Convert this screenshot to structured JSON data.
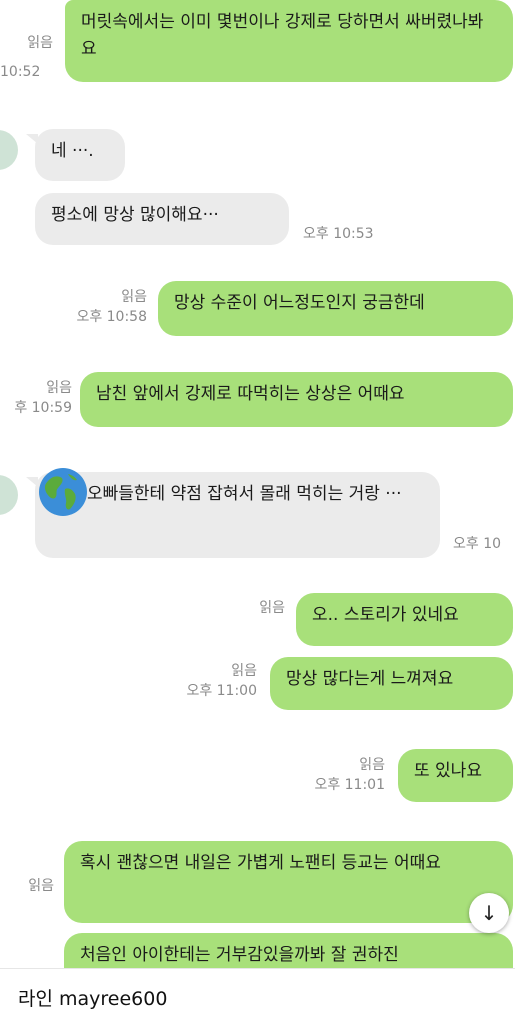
{
  "chat": {
    "messages": [
      {
        "sender": "me",
        "text": "머릿속에서는 이미 몇번이나 강제로 당하면서 싸버렸나봐요",
        "read": "읽음",
        "time": "10:52"
      },
      {
        "sender": "them",
        "text": "네 ···.",
        "time": ""
      },
      {
        "sender": "them",
        "text": "평소에 망상 많이해요···",
        "time": "오후 10:53"
      },
      {
        "sender": "me",
        "text": "망상 수준이 어느정도인지 궁금한데",
        "read": "읽음",
        "time": "오후 10:58"
      },
      {
        "sender": "me",
        "text": "남친 앞에서 강제로 따먹히는 상상은 어때요",
        "read": "읽음",
        "time": "후 10:59"
      },
      {
        "sender": "them",
        "text": "오빠들한테 약점 잡혀서 몰래 먹히는 거랑 ···",
        "time": "오후 10"
      },
      {
        "sender": "me",
        "text": "오.. 스토리가 있네요",
        "read": "읽음",
        "time": ""
      },
      {
        "sender": "me",
        "text": "망상 많다는게 느껴져요",
        "read": "읽음",
        "time": "오후 11:00"
      },
      {
        "sender": "me",
        "text": "또 있나요",
        "read": "읽음",
        "time": "오후 11:01"
      },
      {
        "sender": "me",
        "text": "혹시 괜찮으면 내일은 가볍게 노팬티 등교는 어때요",
        "read": "읽음",
        "time": ""
      },
      {
        "sender": "me",
        "text": "처음인 아이한테는 거부감있을까봐 잘 권하진",
        "time": ""
      }
    ],
    "scroll_button_icon": "↓"
  },
  "footer": {
    "text": "라인 mayree600"
  },
  "colors": {
    "my_bubble": "#a8e07a",
    "their_bubble": "#ebebeb",
    "meta_text": "#8a8a8a"
  },
  "icons": [
    "globe-icon",
    "arrow-down-icon"
  ]
}
